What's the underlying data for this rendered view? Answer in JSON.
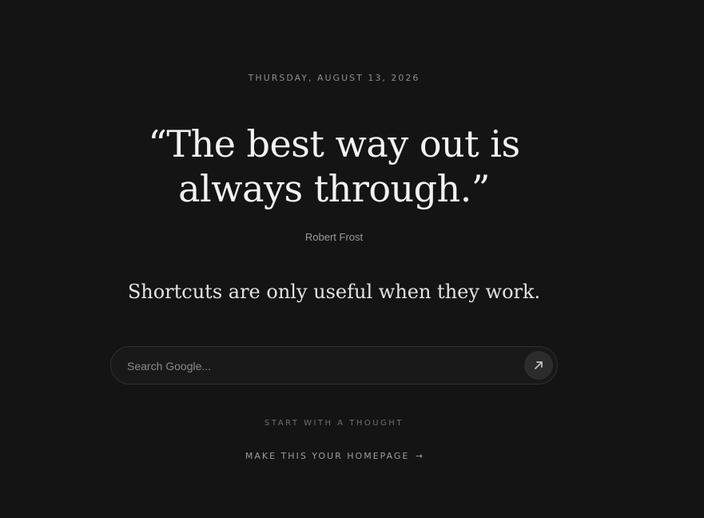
{
  "page": {
    "date": "THURSDAY, AUGUST 13, 2026",
    "quote": {
      "text": "“The best way out is always through.”",
      "author": "Robert Frost"
    },
    "tagline": "Shortcuts are only useful when they work.",
    "search": {
      "placeholder": "Search Google...",
      "value": "",
      "submit_icon": "arrow-up-right-icon"
    },
    "hint": "START WITH A THOUGHT",
    "homepage_link": {
      "label": "MAKE THIS YOUR HOMEPAGE",
      "arrow": "→"
    }
  },
  "colors": {
    "background": "#141414",
    "search_bg": "#191919",
    "search_border": "#2f2f2f",
    "button_bg": "#2c2c2c",
    "text_primary": "#f2f2f2",
    "text_muted": "#8d8d8d"
  }
}
